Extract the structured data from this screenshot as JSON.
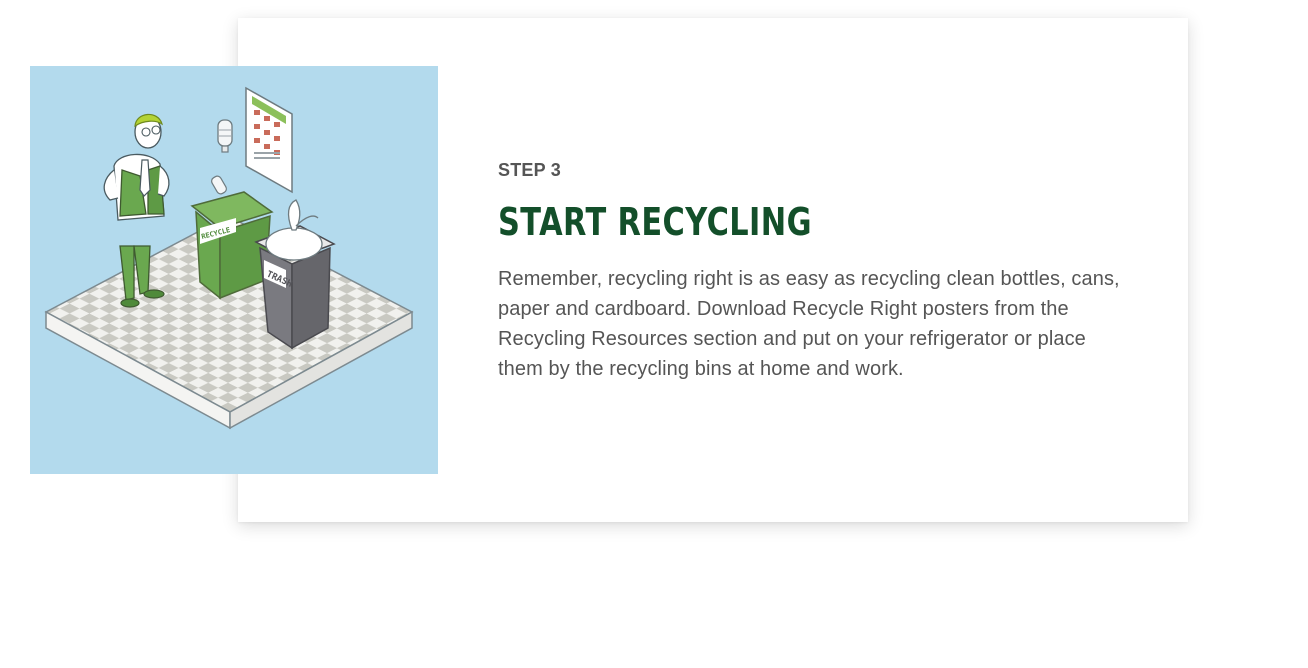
{
  "step": {
    "label": "STEP 3",
    "title": "START RECYCLING",
    "description": "Remember, recycling right is as easy as recycling clean bottles, cans, paper and cardboard. Download Recycle Right posters from the Recycling Resources section and put on your refrigerator or place them by the recycling bins at home and work."
  },
  "illustration": {
    "recycle_bin_label": "RECYCLE",
    "trash_bin_label": "TRASH"
  },
  "colors": {
    "title_green": "#134f2a",
    "illustration_bg": "#b3daed",
    "bin_green": "#6aa84f",
    "bin_gray": "#6b6b70",
    "text_gray": "#555555"
  }
}
